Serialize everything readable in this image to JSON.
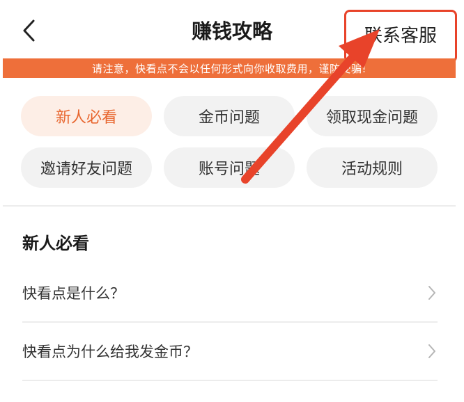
{
  "header": {
    "title": "赚钱攻略",
    "service_label": "联系客服"
  },
  "notice": {
    "text": "请注意，快看点不会以任何形式向你收取费用，谨防受骗!"
  },
  "chips": [
    {
      "label": "新人必看",
      "active": true
    },
    {
      "label": "金币问题",
      "active": false
    },
    {
      "label": "领取现金问题",
      "active": false
    },
    {
      "label": "邀请好友问题",
      "active": false
    },
    {
      "label": "账号问题",
      "active": false
    },
    {
      "label": "活动规则",
      "active": false
    }
  ],
  "section": {
    "title": "新人必看",
    "items": [
      {
        "label": "快看点是什么？"
      },
      {
        "label": "快看点为什么给我发金币？"
      }
    ]
  },
  "colors": {
    "accent": "#e8432a",
    "notice_bg": "#ee6f3a",
    "chip_active_bg": "#fdeee6",
    "chip_active_text": "#e8662f"
  },
  "icons": {
    "back": "chevron-left-icon",
    "item_arrow": "chevron-right-icon"
  }
}
